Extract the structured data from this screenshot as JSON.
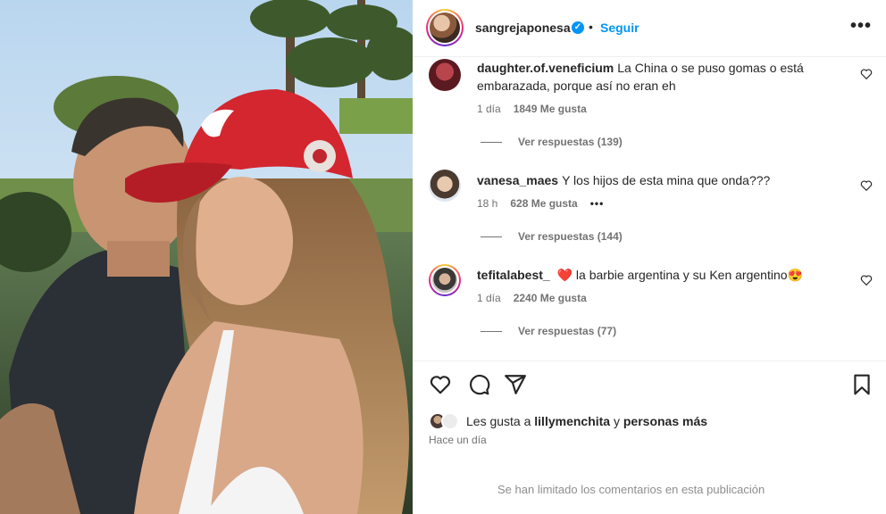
{
  "post": {
    "username": "sangrejaponesa",
    "verified_mark": "✓",
    "separator": "•",
    "follow_label": "Seguir",
    "more_label": "•••"
  },
  "comments": [
    {
      "username": "daughter.of.veneficium",
      "text": "La China o se puso gomas o está embarazada, porque así no eran eh",
      "time": "1 día",
      "likes": "1849 Me gusta",
      "replies": "Ver respuestas (139)"
    },
    {
      "username": "vanesa_maes",
      "text": "Y los hijos de esta mina que onda???",
      "time": "18 h",
      "likes": "628 Me gusta",
      "extra": "•••",
      "replies": "Ver respuestas (144)"
    },
    {
      "username": "tefitalabest_",
      "text_pre": "❤️",
      "text": "la barbie argentina y su Ken argentino",
      "text_post": "😍",
      "time": "1 día",
      "likes": "2240 Me gusta",
      "replies": "Ver respuestas (77)"
    }
  ],
  "likes_summary": {
    "prefix": "Les gusta a ",
    "user": "lillymenchita",
    "middle": " y ",
    "rest": "personas más"
  },
  "timestamp": "Hace un día",
  "limited_notice": "Se han limitado los comentarios en esta publicación",
  "icons": [
    "heart-icon",
    "comment-icon",
    "share-icon",
    "bookmark-icon",
    "more-options-icon",
    "verified-icon"
  ],
  "colors": {
    "accent": "#0095f6",
    "text": "#262626",
    "muted": "#737373",
    "heart": "#ed4956"
  }
}
